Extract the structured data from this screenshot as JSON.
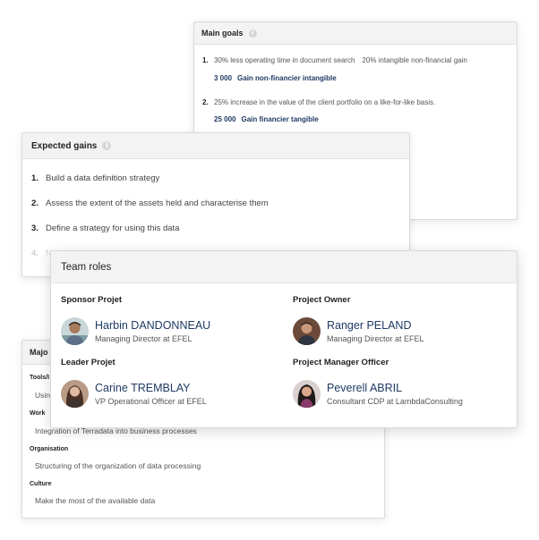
{
  "main_goals": {
    "title": "Main goals",
    "items": [
      {
        "num": "1.",
        "text": "30% less operating time in document search",
        "text2": "20% intangible non-financial gain",
        "gain_value": "3 000",
        "gain_label": "Gain non-financier intangible"
      },
      {
        "num": "2.",
        "text": "25% increase in the value of the client portfolio on a like-for-like basis.",
        "text2": "",
        "gain_value": "25 000",
        "gain_label": "Gain financier tangible"
      }
    ]
  },
  "expected_gains": {
    "title": "Expected gains",
    "items": [
      {
        "num": "1.",
        "text": "Build a data definition strategy"
      },
      {
        "num": "2.",
        "text": "Assess the extent of the assets held and characterise them"
      },
      {
        "num": "3.",
        "text": "Define a strategy for using this data"
      },
      {
        "num": "4.",
        "text": "N"
      }
    ]
  },
  "major": {
    "title": "Majo",
    "sections": [
      {
        "category": "Tools/I",
        "text": "Usin"
      },
      {
        "category": "Work",
        "text": "Integration of Terradata into business processes"
      },
      {
        "category": "Organisation",
        "text": "Structuring of the organization of data processing"
      },
      {
        "category": "Culture",
        "text": "Make the most of the available data"
      }
    ]
  },
  "team_roles": {
    "title": "Team roles",
    "roles": [
      {
        "role": "Sponsor Projet",
        "name": "Harbin DANDONNEAU",
        "title": "Managing Director at EFEL"
      },
      {
        "role": "Project Owner",
        "name": "Ranger PELAND",
        "title": "Managing Director at EFEL"
      },
      {
        "role": "Leader Projet",
        "name": "Carine TREMBLAY",
        "title": "VP Operational Officer at EFEL"
      },
      {
        "role": "Project Manager Officer",
        "name": "Peverell ABRIL",
        "title": "Consultant CDP at LambdaConsulting"
      }
    ]
  },
  "colors": {
    "accent_name": "#1f3a63",
    "header_bg": "#f3f3f3",
    "info_icon": "#d6d6d6"
  },
  "icons": {
    "info": "info-icon"
  }
}
